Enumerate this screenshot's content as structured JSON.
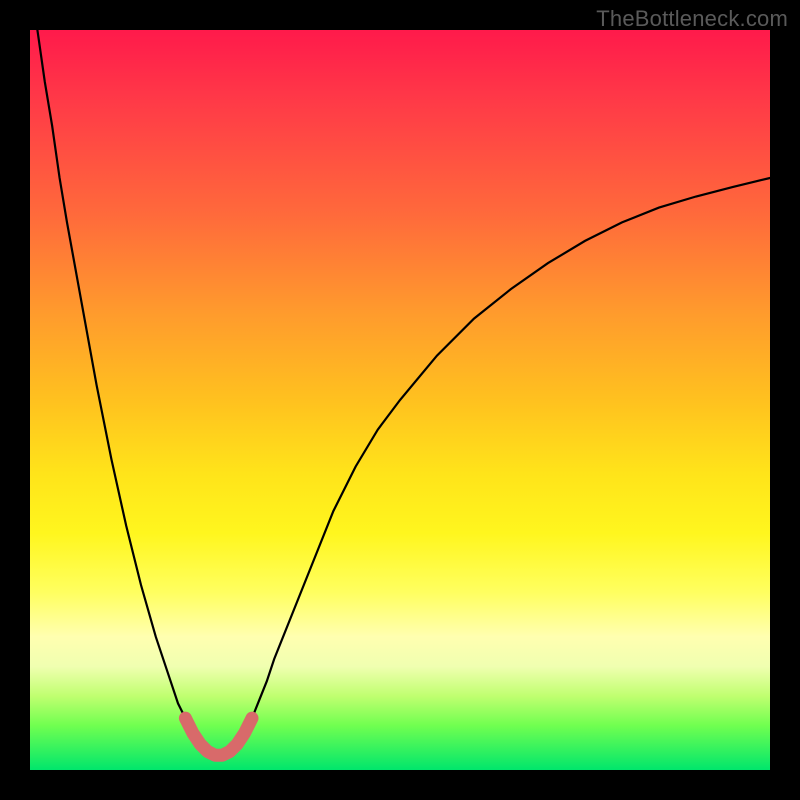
{
  "watermark": {
    "text": "TheBottleneck.com"
  },
  "colors": {
    "curve_stroke": "#000000",
    "highlight_stroke": "#d86a6a",
    "background_black": "#000000"
  },
  "chart_data": {
    "type": "line",
    "title": "",
    "xlabel": "",
    "ylabel": "",
    "xlim": [
      0,
      100
    ],
    "ylim": [
      0,
      100
    ],
    "grid": false,
    "legend": false,
    "x": [
      0,
      1,
      2,
      3,
      4,
      5,
      7,
      9,
      11,
      13,
      15,
      17,
      19,
      20,
      21,
      22,
      23,
      24,
      25,
      26,
      27,
      28,
      29,
      30,
      31,
      32,
      33,
      35,
      37,
      39,
      41,
      44,
      47,
      50,
      55,
      60,
      65,
      70,
      75,
      80,
      85,
      90,
      95,
      100
    ],
    "series": [
      {
        "name": "bottleneck-curve",
        "values": [
          null,
          100,
          93,
          87,
          80,
          74,
          63,
          52,
          42,
          33,
          25,
          18,
          12,
          9,
          7,
          5,
          3.5,
          2.5,
          2,
          2,
          2.5,
          3.5,
          5,
          7,
          9.5,
          12,
          15,
          20,
          25,
          30,
          35,
          41,
          46,
          50,
          56,
          61,
          65,
          68.5,
          71.5,
          74,
          76,
          77.5,
          78.8,
          80
        ]
      }
    ],
    "highlight_segment": {
      "x": [
        21,
        22,
        23,
        24,
        25,
        26,
        27,
        28,
        29,
        30
      ],
      "values": [
        7,
        5,
        3.5,
        2.5,
        2,
        2,
        2.5,
        3.5,
        5,
        7
      ]
    }
  }
}
